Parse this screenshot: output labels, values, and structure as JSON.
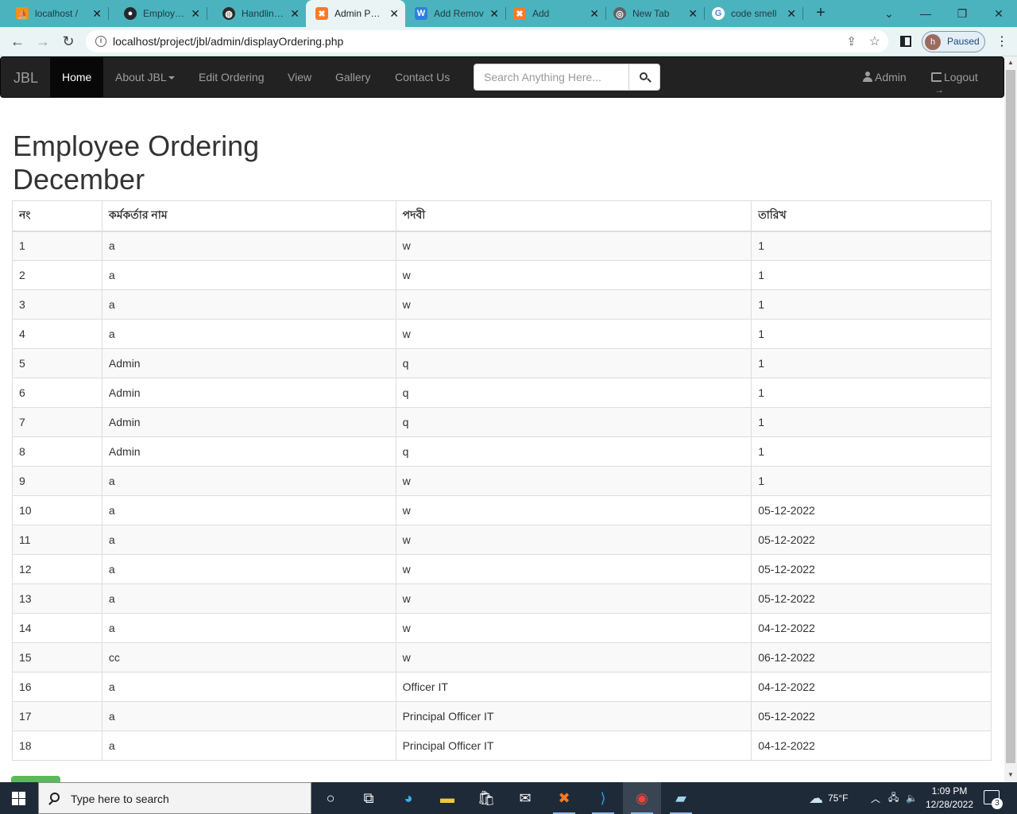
{
  "browser": {
    "tabs": [
      {
        "title": "localhost /",
        "favicon": "phpmyadmin-icon",
        "active": false
      },
      {
        "title": "Employee_O",
        "favicon": "github-icon",
        "active": false
      },
      {
        "title": "Handling U",
        "favicon": "globe-icon",
        "active": false
      },
      {
        "title": "Admin Page",
        "favicon": "xampp-icon",
        "active": true
      },
      {
        "title": "Add Remov",
        "favicon": "w3schools-icon",
        "active": false
      },
      {
        "title": "Add",
        "favicon": "xampp-icon",
        "active": false
      },
      {
        "title": "New Tab",
        "favicon": "chrome-icon",
        "active": false
      },
      {
        "title": "code smell",
        "favicon": "google-icon",
        "active": false
      }
    ],
    "new_tab_label": "+",
    "url": "localhost/project/jbl/admin/displayOrdering.php",
    "profile_initial": "h",
    "profile_status": "Paused"
  },
  "navbar": {
    "brand": "JBL",
    "items": [
      "Home",
      "About JBL",
      "Edit Ordering",
      "View",
      "Gallery",
      "Contact Us"
    ],
    "search_placeholder": "Search Anything Here...",
    "admin_label": "Admin",
    "logout_label": "Logout"
  },
  "page": {
    "title_line1": "Employee Ordering",
    "title_line2": "December"
  },
  "table": {
    "headers": [
      "নং",
      "কর্মকর্তার নাম",
      "পদবী",
      "তারিখ"
    ],
    "rows": [
      [
        "1",
        "a",
        "w",
        "1"
      ],
      [
        "2",
        "a",
        "w",
        "1"
      ],
      [
        "3",
        "a",
        "w",
        "1"
      ],
      [
        "4",
        "a",
        "w",
        "1"
      ],
      [
        "5",
        "Admin",
        "q",
        "1"
      ],
      [
        "6",
        "Admin",
        "q",
        "1"
      ],
      [
        "7",
        "Admin",
        "q",
        "1"
      ],
      [
        "8",
        "Admin",
        "q",
        "1"
      ],
      [
        "9",
        "a",
        "w",
        "1"
      ],
      [
        "10",
        "a",
        "w",
        "05-12-2022"
      ],
      [
        "11",
        "a",
        "w",
        "05-12-2022"
      ],
      [
        "12",
        "a",
        "w",
        "05-12-2022"
      ],
      [
        "13",
        "a",
        "w",
        "05-12-2022"
      ],
      [
        "14",
        "a",
        "w",
        "04-12-2022"
      ],
      [
        "15",
        "cc",
        "w",
        "06-12-2022"
      ],
      [
        "16",
        "a",
        "Officer IT",
        "04-12-2022"
      ],
      [
        "17",
        "a",
        "Principal Officer IT",
        "05-12-2022"
      ],
      [
        "18",
        "a",
        "Principal Officer IT",
        "04-12-2022"
      ]
    ]
  },
  "taskbar": {
    "search_text": "Type here to search",
    "weather": "75°F",
    "time": "1:09 PM",
    "date": "12/28/2022",
    "notification_count": "3"
  },
  "colors": {
    "tabstrip": "#4bb3be",
    "navbar": "#222222",
    "accent_green": "#5cb85c"
  }
}
